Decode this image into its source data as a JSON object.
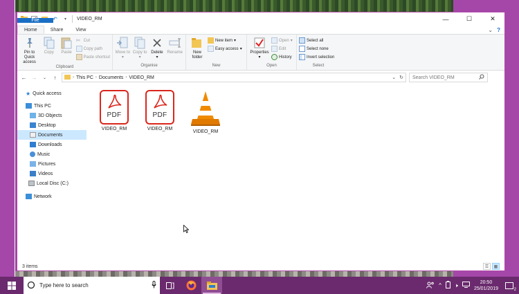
{
  "window": {
    "title": "VIDEO_RM",
    "controls": {
      "minimize": "—",
      "maximize": "☐",
      "close": "✕"
    }
  },
  "ribbon_tabs": {
    "file": "File",
    "home": "Home",
    "share": "Share",
    "view": "View"
  },
  "ribbon": {
    "clipboard": {
      "label": "Clipboard",
      "pin": "Pin to Quick access",
      "copy": "Copy",
      "paste": "Paste",
      "cut": "Cut",
      "copy_path": "Copy path",
      "paste_shortcut": "Paste shortcut"
    },
    "organise": {
      "label": "Organise",
      "move_to": "Move to",
      "copy_to": "Copy to",
      "delete": "Delete",
      "rename": "Rename"
    },
    "new": {
      "label": "New",
      "new_folder": "New folder",
      "new_item": "New item",
      "easy_access": "Easy access"
    },
    "open": {
      "label": "Open",
      "properties": "Properties",
      "open": "Open",
      "edit": "Edit",
      "history": "History"
    },
    "select": {
      "label": "Select",
      "select_all": "Select all",
      "select_none": "Select none",
      "invert_selection": "Invert selection"
    }
  },
  "address": {
    "crumbs": [
      "This PC",
      "Documents",
      "VIDEO_RM"
    ],
    "search_placeholder": "Search VIDEO_RM"
  },
  "nav_pane": {
    "items": [
      {
        "label": "Quick access",
        "icon": "star-icon"
      },
      {
        "label": "This PC",
        "icon": "computer-icon"
      },
      {
        "label": "3D Objects",
        "icon": "3d-objects-icon"
      },
      {
        "label": "Desktop",
        "icon": "desktop-icon"
      },
      {
        "label": "Documents",
        "icon": "documents-icon",
        "selected": true
      },
      {
        "label": "Downloads",
        "icon": "downloads-icon"
      },
      {
        "label": "Music",
        "icon": "music-icon"
      },
      {
        "label": "Pictures",
        "icon": "pictures-icon"
      },
      {
        "label": "Videos",
        "icon": "videos-icon"
      },
      {
        "label": "Local Disc (C:)",
        "icon": "drive-icon"
      },
      {
        "label": "Network",
        "icon": "network-icon"
      }
    ]
  },
  "files": [
    {
      "name": "VIDEO_RM",
      "type": "pdf",
      "icon_text": "PDF"
    },
    {
      "name": "VIDEO_RM",
      "type": "pdf",
      "icon_text": "PDF"
    },
    {
      "name": "VIDEO_RM",
      "type": "vlc"
    }
  ],
  "status": {
    "item_count": "3 items"
  },
  "taskbar": {
    "search_placeholder": "Type here to search",
    "time": "20:50",
    "date": "25/01/2019",
    "notification_count": "2"
  },
  "colors": {
    "accent": "#1a6fc4",
    "taskbar": "#6a2a6d",
    "desktop": "#a447a9",
    "selection": "#cce8ff",
    "pdf_red": "#d9261c",
    "vlc_orange": "#f08a00"
  }
}
